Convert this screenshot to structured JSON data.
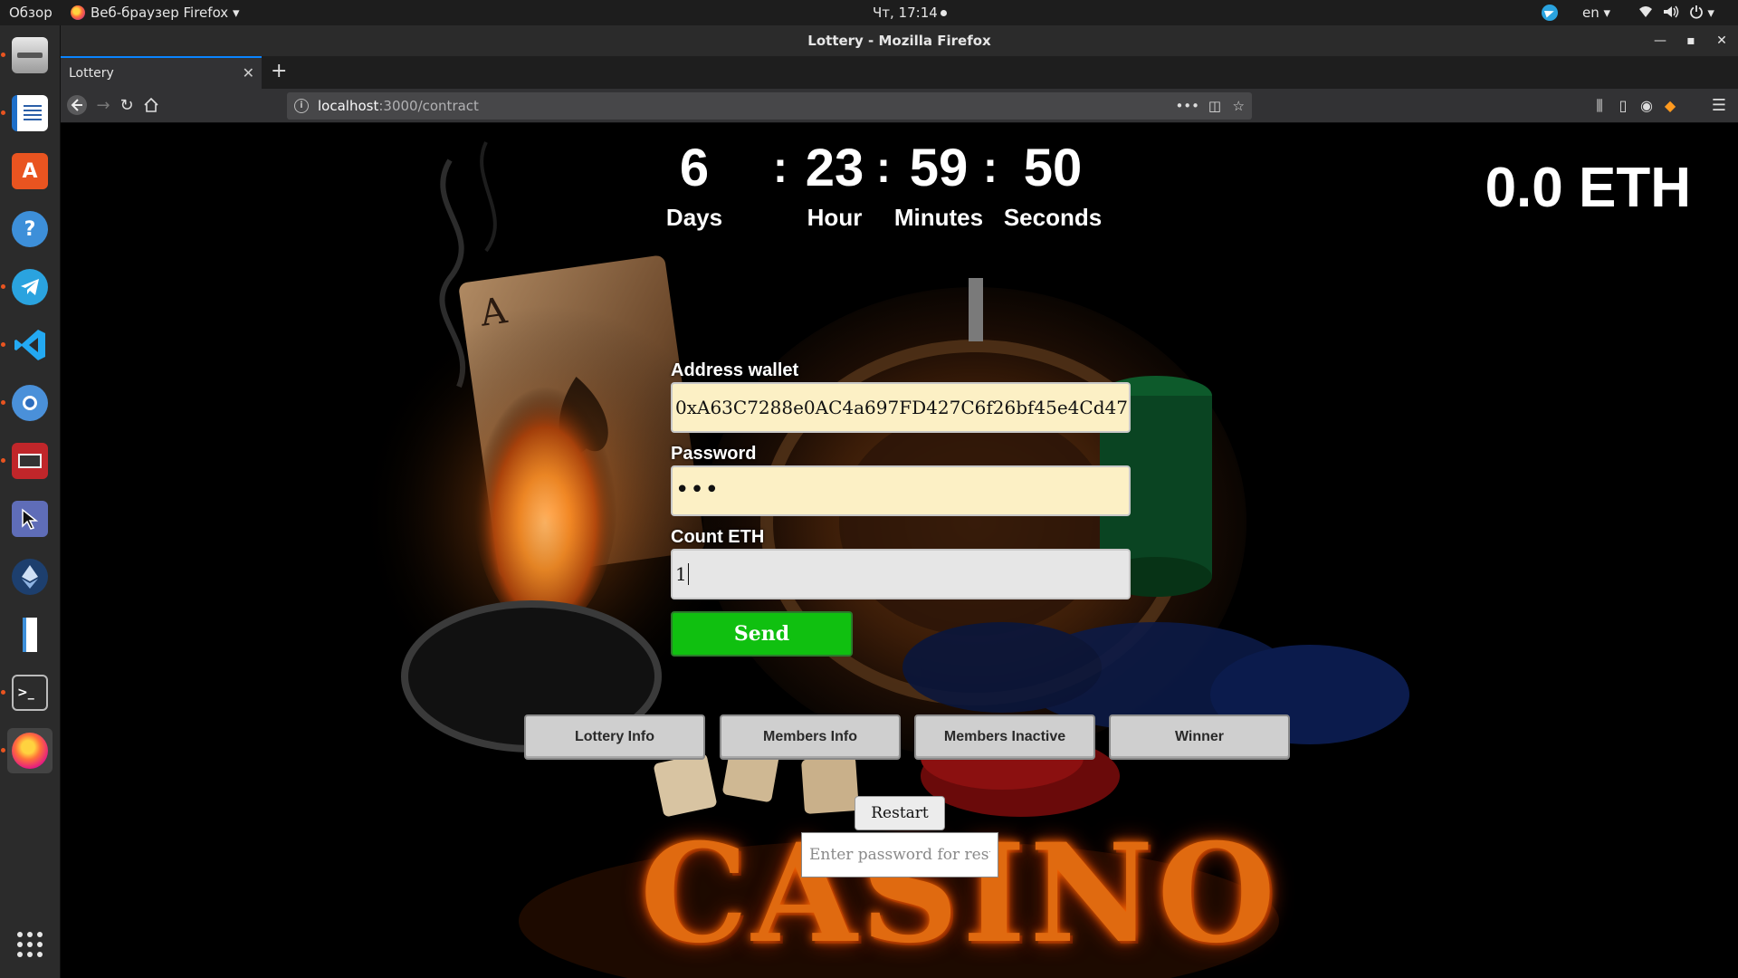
{
  "topbar": {
    "overview": "Обзор",
    "app_menu": "Веб-браузер Firefox",
    "clock": "Чт, 17:14",
    "lang": "en"
  },
  "dock": {
    "items": [
      "files-icon",
      "writer-icon",
      "software-center-icon",
      "help-icon",
      "telegram-icon",
      "vscode-icon",
      "chromium-icon",
      "remote-desktop-icon",
      "screenshot-tool-icon",
      "ethereum-wallet-icon",
      "text-editor-icon",
      "terminal-icon",
      "firefox-icon"
    ],
    "apps_grid": "show-applications-icon"
  },
  "browser": {
    "window_title": "Lottery - Mozilla Firefox",
    "tab_title": "Lottery",
    "url_host": "localhost",
    "url_path": ":3000/contract"
  },
  "countdown": {
    "days": "6",
    "hours": "23",
    "minutes": "59",
    "seconds": "50",
    "days_label": "Days",
    "hours_label": "Hour",
    "minutes_label": "Minutes",
    "seconds_label": "Seconds",
    "separator": ":"
  },
  "balance": "0.0 ETH",
  "form": {
    "address_label": "Address wallet",
    "address_value": "0xA63C7288e0AC4a697FD427C6f26bf45e4Cd47",
    "password_label": "Password",
    "password_value": "•••",
    "count_label": "Count ETH",
    "count_value": "1",
    "send_label": "Send"
  },
  "tabs": [
    "Lottery Info",
    "Members Info",
    "Members Inactive",
    "Winner"
  ],
  "restart": {
    "button_label": "Restart",
    "password_placeholder": "Enter password for restart"
  },
  "background_text": "CASINO",
  "colors": {
    "send_button": "#10c010",
    "input_fill": "#fcf0c5",
    "accent_tab": "#0a84ff"
  }
}
